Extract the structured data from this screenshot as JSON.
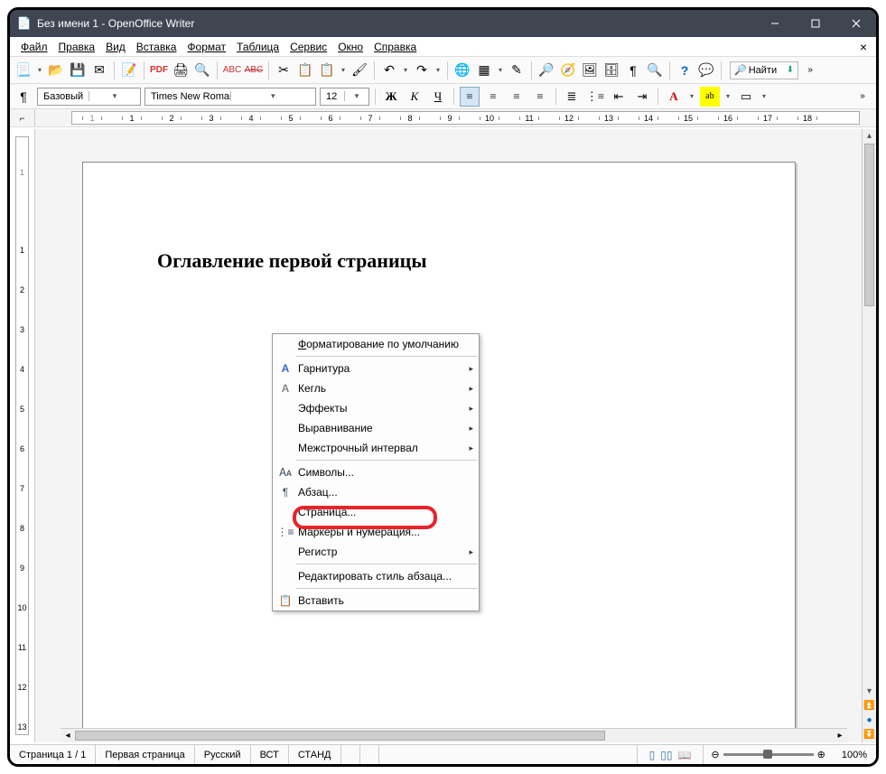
{
  "window": {
    "title": "Без имени 1 - OpenOffice Writer"
  },
  "menubar": [
    "Файл",
    "Правка",
    "Вид",
    "Вставка",
    "Формат",
    "Таблица",
    "Сервис",
    "Окно",
    "Справка"
  ],
  "find_label": "Найти",
  "format": {
    "style": "Базовый",
    "font": "Times New Roman",
    "size": "12",
    "bold": "Ж",
    "italic": "К",
    "underline": "Ч"
  },
  "ruler_h": [
    "1",
    "",
    "1",
    "2",
    "3",
    "4",
    "5",
    "6",
    "7",
    "8",
    "9",
    "10",
    "11",
    "12",
    "13",
    "14",
    "15",
    "16",
    "17",
    "18"
  ],
  "ruler_v": [
    "",
    "1",
    "",
    "1",
    "2",
    "3",
    "4",
    "5",
    "6",
    "7",
    "8",
    "9",
    "10",
    "11",
    "12",
    "13"
  ],
  "document": {
    "heading": "Оглавление первой страницы"
  },
  "context_menu": {
    "default_format": "Форматирование по умолчанию",
    "typeface": "Гарнитура",
    "size": "Кегль",
    "effects": "Эффекты",
    "align": "Выравнивание",
    "linespacing": "Межстрочный интервал",
    "characters": "Символы...",
    "paragraph": "Абзац...",
    "page": "Страница...",
    "bullets": "Маркеры и нумерация...",
    "case": "Регистр",
    "edit_para_style": "Редактировать стиль абзаца...",
    "paste": "Вставить"
  },
  "status": {
    "page": "Страница  1 / 1",
    "page_style": "Первая страница",
    "lang": "Русский",
    "ins": "ВСТ",
    "stand": "СТАНД",
    "zoom": "100%"
  }
}
